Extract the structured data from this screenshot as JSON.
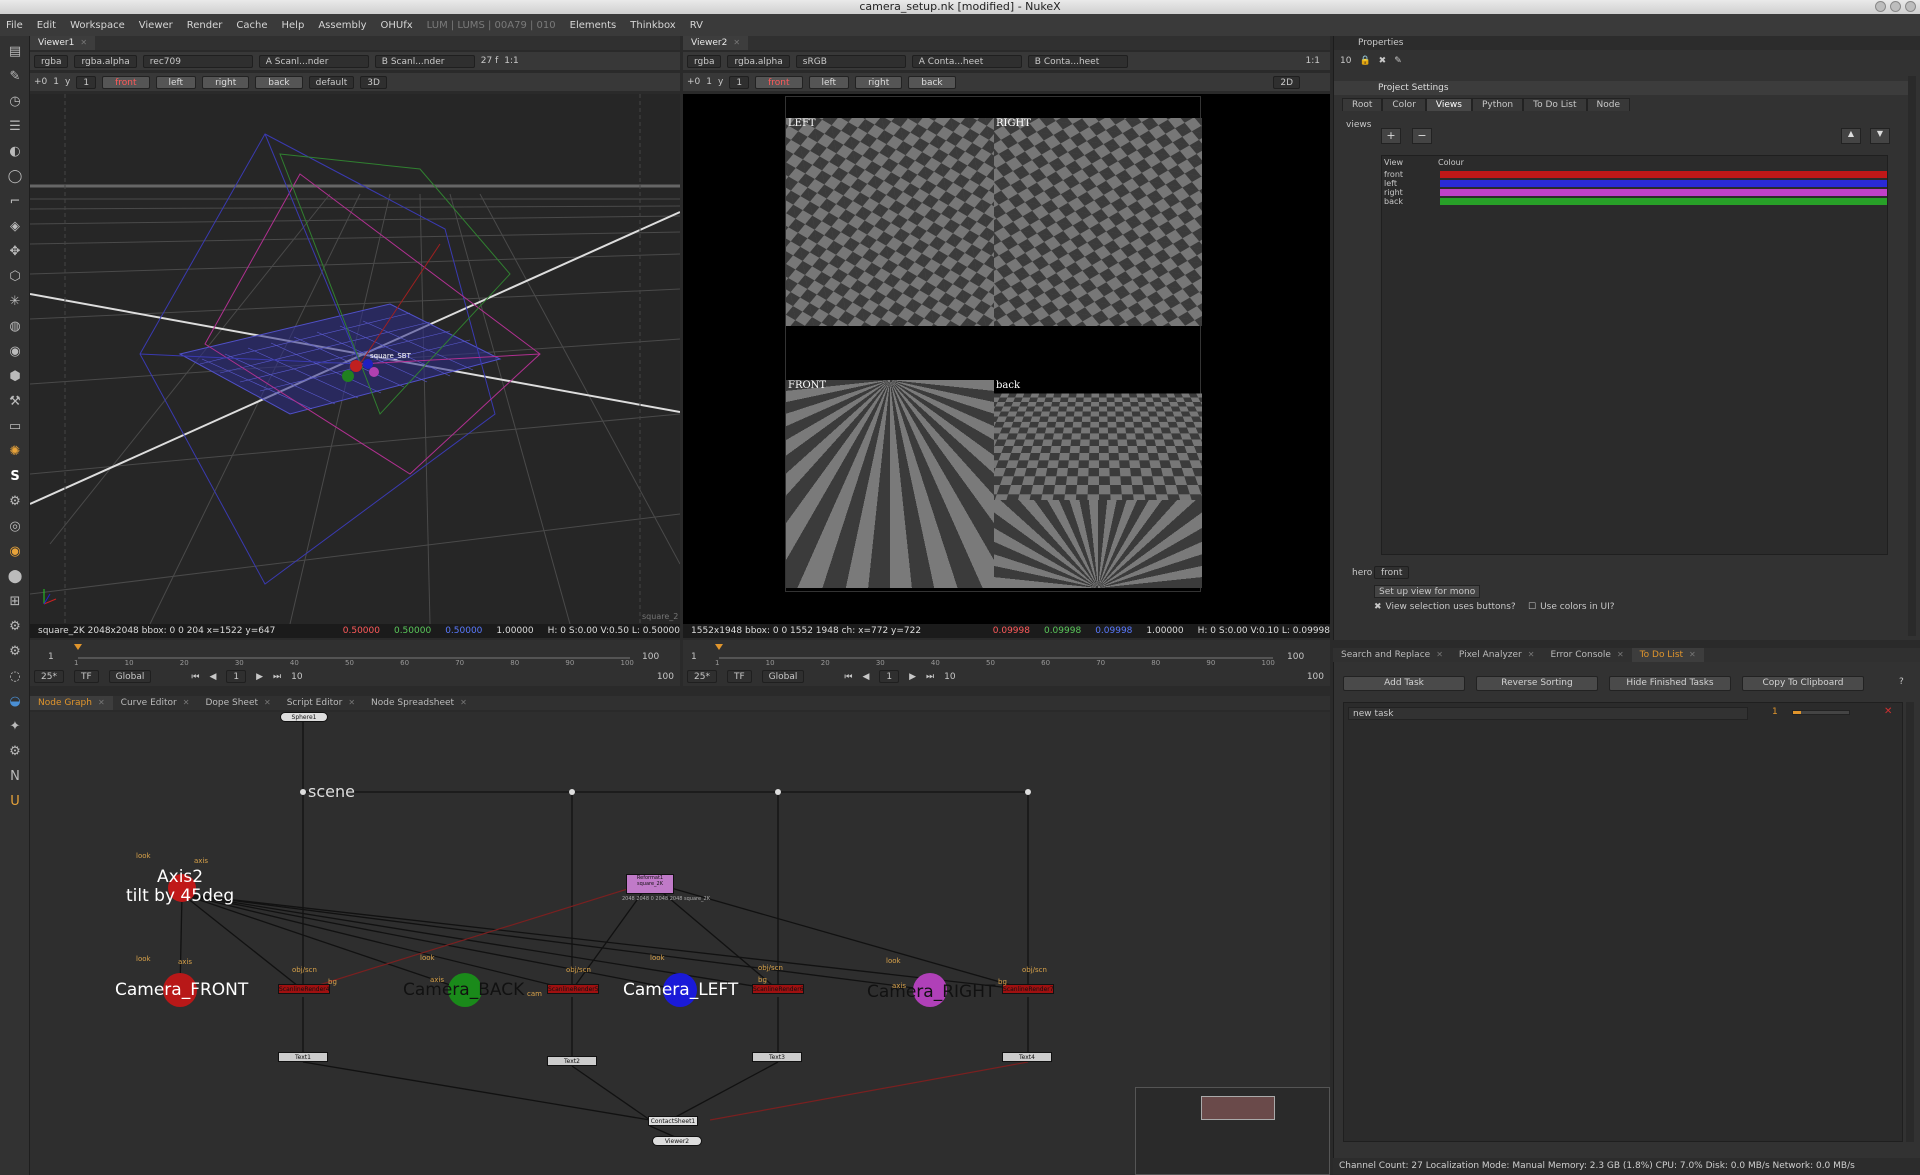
{
  "window": {
    "title": "camera_setup.nk [modified] - NukeX"
  },
  "menu": {
    "items": [
      "File",
      "Edit",
      "Workspace",
      "Viewer",
      "Render",
      "Cache",
      "Help",
      "Assembly",
      "OHUfx"
    ],
    "dim": "LUM | LUMS | 00A79 | 010",
    "items2": [
      "Elements",
      "Thinkbox",
      "RV"
    ]
  },
  "viewer1": {
    "tab": "Viewer1",
    "channels": "rgba",
    "alpha": "rgba.alpha",
    "colorspace": "rec709",
    "input_a": "A  Scanl...nder",
    "input_b": "B  Scanl...nder",
    "gain": "27 f",
    "zoom": "1:1",
    "frame_plus": "+0",
    "frame_num": "1",
    "y_label": "y",
    "y_val": "1",
    "views": [
      "front",
      "left",
      "right",
      "back"
    ],
    "lut": "default",
    "mode": "3D",
    "info": "square_2K 2048x2048  bbox: 0 0 204  x=1522 y=647",
    "pixel_r": "0.50000",
    "pixel_g": "0.50000",
    "pixel_b": "0.50000",
    "pixel_a": "1.00000",
    "hsv": "H: 0 S:0.00 V:0.50  L: 0.50000",
    "scene_label": "square_SBT",
    "corner_label": "square_2"
  },
  "viewer2": {
    "tab": "Viewer2",
    "channels": "rgba",
    "alpha": "rgba.alpha",
    "colorspace": "sRGB",
    "input_a": "A  Conta...heet",
    "input_b": "B  Conta...heet",
    "zoom": "1:1",
    "frame_plus": "+0",
    "frame_num": "1",
    "y_label": "y",
    "y_val": "1",
    "views": [
      "front",
      "left",
      "right",
      "back"
    ],
    "mode": "2D",
    "quads": [
      "LEFT",
      "RIGHT",
      "FRONT",
      "back"
    ],
    "info": "1552x1948  bbox: 0 0 1552 1948 ch:  x=772 y=722",
    "pixel_r": "0.09998",
    "pixel_g": "0.09998",
    "pixel_b": "0.09998",
    "pixel_a": "1.00000",
    "hsv": "H: 0 S:0.00 V:0.10  L: 0.09998"
  },
  "timeline": {
    "ticks": [
      "1",
      "10",
      "20",
      "30",
      "40",
      "50",
      "60",
      "70",
      "80",
      "90",
      "100"
    ],
    "start": "1",
    "end": "100",
    "fps": "25*",
    "tf": "TF",
    "scope": "Global",
    "current": "1",
    "step": "10"
  },
  "properties": {
    "title": "Properties",
    "count": "10",
    "node": "Project Settings",
    "tabs": [
      "Root",
      "Color",
      "Views",
      "Python",
      "To Do List",
      "Node"
    ],
    "active_tab": "Views",
    "views_label": "views",
    "headers": {
      "view": "View",
      "colour": "Colour"
    },
    "views": [
      {
        "name": "front",
        "color": "#c01818"
      },
      {
        "name": "left",
        "color": "#2a2ad8"
      },
      {
        "name": "right",
        "color": "#c040c8"
      },
      {
        "name": "back",
        "color": "#28a028"
      }
    ],
    "hero_label": "hero",
    "hero_value": "front",
    "setup_mono": "Set up view for mono",
    "view_buttons": "View selection uses buttons?",
    "use_colors": "Use colors in UI?"
  },
  "bottom_tabs": {
    "tabs": [
      "Search and Replace",
      "Pixel Analyzer",
      "Error Console",
      "To Do List"
    ],
    "active": "To Do List"
  },
  "todo": {
    "buttons": [
      "Add Task",
      "Reverse Sorting",
      "Hide Finished Tasks",
      "Copy To Clipboard"
    ],
    "help": "?",
    "tasks": [
      {
        "name": "new task",
        "priority": "1"
      }
    ]
  },
  "status": "Channel Count: 27  Localization Mode: Manual  Memory: 2.3 GB (1.8%)  CPU: 7.0%  Disk: 0.0 MB/s  Network: 0.0 MB/s",
  "nodegraph_tabs": [
    "Node Graph",
    "Curve Editor",
    "Dope Sheet",
    "Script Editor",
    "Node Spreadsheet"
  ],
  "nodegraph": {
    "sphere": "Sphere1",
    "scene": "scene",
    "axis_line1": "Axis2",
    "axis_line2": "tilt by 45deg",
    "cameras": [
      "Camera_FRONT",
      "Camera_BACK",
      "Camera_LEFT",
      "Camera_RIGHT"
    ],
    "reformat": "Reformat1",
    "reformat_sub": "square_2K",
    "reformat_info": "2048 2048 0 2048 2048 square_2K",
    "scanline": [
      "ScanlineRender4",
      "ScanlineRender5",
      "ScanlineRender6",
      "ScanlineRender7"
    ],
    "text_nodes": [
      "Text1",
      "Text2",
      "Text3",
      "Text4"
    ],
    "contact": "ContactSheet1",
    "viewer": "Viewer2",
    "small_labels": {
      "look": "look",
      "axis": "axis",
      "objscn": "obj/scn",
      "bg": "bg",
      "cam": "cam"
    }
  }
}
